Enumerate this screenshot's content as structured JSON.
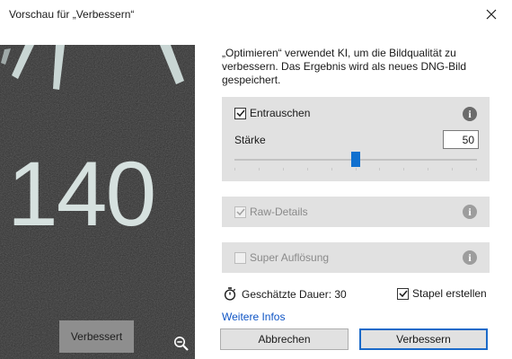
{
  "window": {
    "title": "Vorschau für „Verbessern“",
    "close_icon": "close-icon"
  },
  "preview": {
    "number": "140",
    "label": "Verbessert",
    "zoom_icon": "zoom-out-icon"
  },
  "description": "„Optimieren“ verwendet KI, um die Bildqualität zu verbessern. Das Ergebnis wird als neues DNG-Bild gespeichert.",
  "denoise": {
    "label": "Entrauschen",
    "checked": true,
    "strength_label": "Stärke",
    "strength_value": "50",
    "slider_value": 50,
    "slider_max": 100
  },
  "raw_details": {
    "label": "Raw-Details",
    "checked": true,
    "enabled": false
  },
  "super_resolution": {
    "label": "Super Auflösung",
    "checked": false,
    "enabled": false
  },
  "estimate": {
    "text": "Geschätzte Dauer: 30"
  },
  "stack": {
    "label": "Stapel erstellen",
    "checked": true
  },
  "more_info": "Weitere Infos",
  "buttons": {
    "cancel": "Abbrechen",
    "enhance": "Verbessern"
  },
  "colors": {
    "accent": "#1170cf",
    "panel": "#e1e1e1",
    "link": "#0f55c5"
  }
}
